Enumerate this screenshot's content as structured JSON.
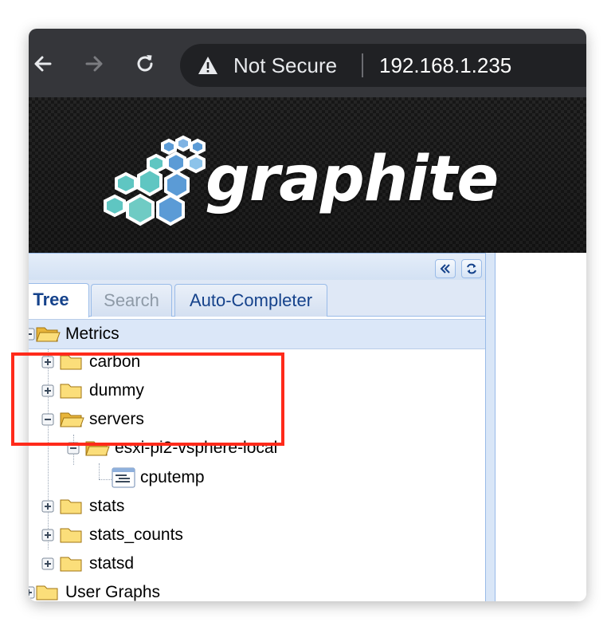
{
  "browser": {
    "security_label": "Not Secure",
    "url": "192.168.1.235",
    "icons": [
      "back-arrow-icon",
      "forward-arrow-icon",
      "reload-icon",
      "warning-icon"
    ]
  },
  "banner": {
    "logo_text": "graphite",
    "colors": {
      "hex_teal": "#5fc6c2",
      "hex_blue": "#5b9bd6",
      "background": "#1b1b1b"
    }
  },
  "panel": {
    "tools": [
      "collapse-icon",
      "refresh-icon"
    ],
    "tabs": [
      {
        "label": "Tree",
        "state": "active"
      },
      {
        "label": "Search",
        "state": "disabled"
      },
      {
        "label": "Auto-Completer",
        "state": "normal"
      }
    ]
  },
  "tree": {
    "metrics": {
      "label": "Metrics",
      "expanded": true
    },
    "carbon": {
      "label": "carbon",
      "expanded": false
    },
    "dummy": {
      "label": "dummy",
      "expanded": false
    },
    "servers": {
      "label": "servers",
      "expanded": true
    },
    "esxi": {
      "label": "esxi-pi2-vsphere-local",
      "expanded": true
    },
    "cputemp": {
      "label": "cputemp",
      "type": "leaf"
    },
    "stats": {
      "label": "stats",
      "expanded": false
    },
    "stats_counts": {
      "label": "stats_counts",
      "expanded": false
    },
    "statsd": {
      "label": "statsd",
      "expanded": false
    },
    "user_graphs": {
      "label": "User Graphs",
      "expanded": false
    }
  },
  "annotation": {
    "color": "#ff2a1a"
  }
}
